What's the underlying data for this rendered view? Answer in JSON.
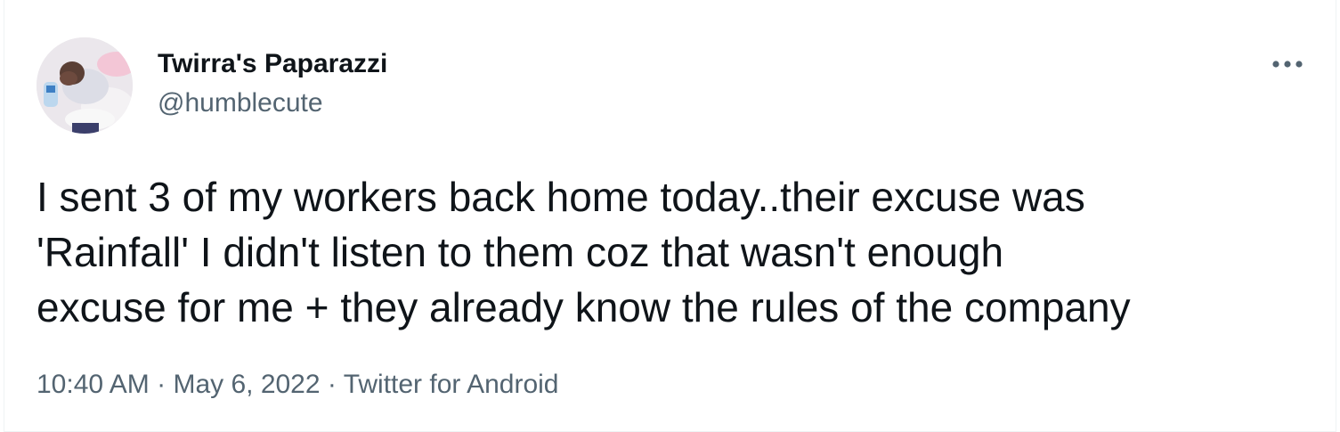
{
  "tweet": {
    "author": {
      "display_name": "Twirra's Paparazzi",
      "handle": "@humblecute",
      "avatar_icon": "profile-photo"
    },
    "more_icon": "ellipsis-icon",
    "text": "I sent 3 of my workers back home today..their excuse was\n'Rainfall' I didn't listen to them coz that wasn't enough\nexcuse for me + they already know the rules of the company",
    "meta": {
      "time": "10:40 AM",
      "separator": "·",
      "date": "May 6, 2022",
      "source": "Twitter for Android"
    }
  },
  "colors": {
    "text_primary": "#0f1419",
    "text_secondary": "#536471",
    "border": "#eff3f4"
  }
}
